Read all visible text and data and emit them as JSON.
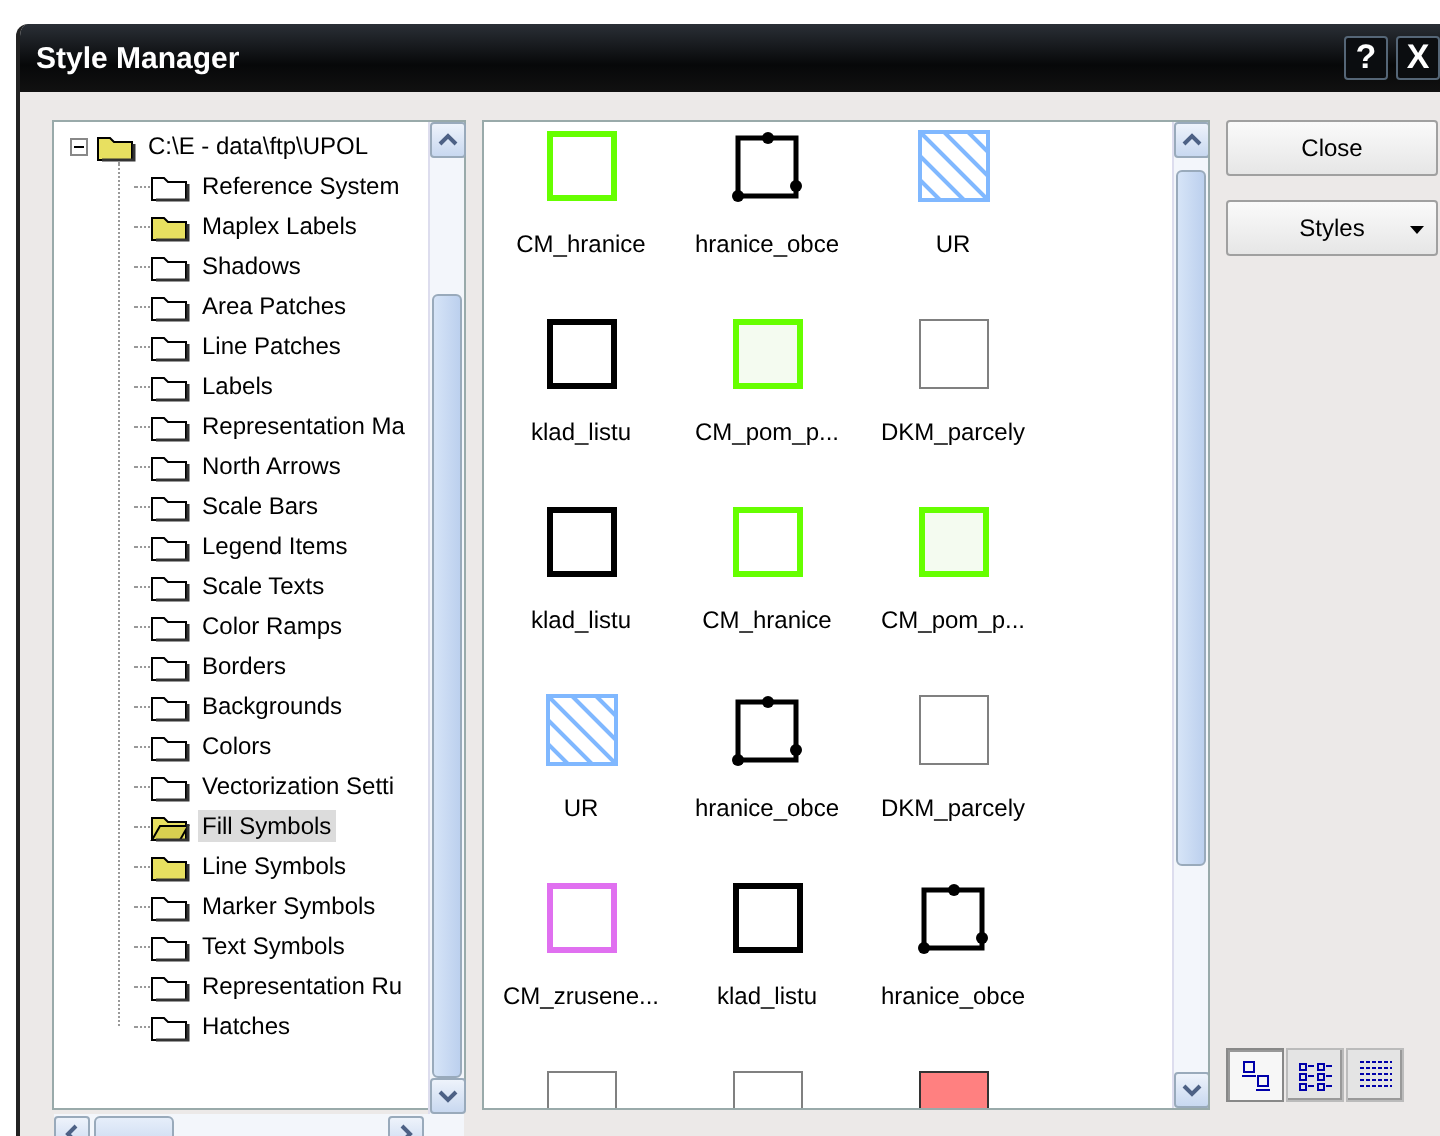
{
  "window": {
    "title": "Style Manager",
    "help": "?",
    "close": "X"
  },
  "tree": {
    "root": {
      "label": "C:\\E - data\\ftp\\UPOL",
      "expanded": true,
      "children": [
        {
          "label": "Reference System",
          "kind": "plain",
          "selected": false
        },
        {
          "label": "Maplex Labels",
          "kind": "yellow",
          "selected": false
        },
        {
          "label": "Shadows",
          "kind": "plain",
          "selected": false
        },
        {
          "label": "Area Patches",
          "kind": "plain",
          "selected": false
        },
        {
          "label": "Line Patches",
          "kind": "plain",
          "selected": false
        },
        {
          "label": "Labels",
          "kind": "plain",
          "selected": false
        },
        {
          "label": "Representation Ma",
          "kind": "plain",
          "selected": false
        },
        {
          "label": "North Arrows",
          "kind": "plain",
          "selected": false
        },
        {
          "label": "Scale Bars",
          "kind": "plain",
          "selected": false
        },
        {
          "label": "Legend Items",
          "kind": "plain",
          "selected": false
        },
        {
          "label": "Scale Texts",
          "kind": "plain",
          "selected": false
        },
        {
          "label": "Color Ramps",
          "kind": "plain",
          "selected": false
        },
        {
          "label": "Borders",
          "kind": "plain",
          "selected": false
        },
        {
          "label": "Backgrounds",
          "kind": "plain",
          "selected": false
        },
        {
          "label": "Colors",
          "kind": "plain",
          "selected": false
        },
        {
          "label": "Vectorization Setti",
          "kind": "plain",
          "selected": false
        },
        {
          "label": "Fill Symbols",
          "kind": "open",
          "selected": true
        },
        {
          "label": "Line Symbols",
          "kind": "yellow",
          "selected": false
        },
        {
          "label": "Marker Symbols",
          "kind": "plain",
          "selected": false
        },
        {
          "label": "Text Symbols",
          "kind": "plain",
          "selected": false
        },
        {
          "label": "Representation Ru",
          "kind": "plain",
          "selected": false
        },
        {
          "label": "Hatches",
          "kind": "plain",
          "selected": false
        }
      ]
    }
  },
  "symbols": [
    {
      "label": "CM_hranice",
      "kind": "outline",
      "color": "#66ff00"
    },
    {
      "label": "hranice_obce",
      "kind": "boundary",
      "color": "#000000"
    },
    {
      "label": "UR",
      "kind": "hatch",
      "color": "#80b8ff"
    },
    {
      "label": "klad_listu",
      "kind": "outline",
      "color": "#000000"
    },
    {
      "label": "CM_pom_p...",
      "kind": "tinted",
      "color": "#66ff00"
    },
    {
      "label": "DKM_parcely",
      "kind": "thin",
      "color": "#808080"
    },
    {
      "label": "klad_listu",
      "kind": "outline",
      "color": "#000000"
    },
    {
      "label": "CM_hranice",
      "kind": "outline",
      "color": "#66ff00"
    },
    {
      "label": "CM_pom_p...",
      "kind": "tinted",
      "color": "#66ff00"
    },
    {
      "label": "UR",
      "kind": "hatch",
      "color": "#80b8ff"
    },
    {
      "label": "hranice_obce",
      "kind": "boundary",
      "color": "#000000"
    },
    {
      "label": "DKM_parcely",
      "kind": "thin",
      "color": "#808080"
    },
    {
      "label": "CM_zrusene...",
      "kind": "outline",
      "color": "#e070f0"
    },
    {
      "label": "klad_listu",
      "kind": "outline",
      "color": "#000000"
    },
    {
      "label": "hranice_obce",
      "kind": "boundary",
      "color": "#000000"
    },
    {
      "kind": "thin",
      "color": "#808080"
    },
    {
      "kind": "thin",
      "color": "#808080"
    },
    {
      "kind": "solid",
      "color": "#ff8080"
    }
  ],
  "buttons": [
    {
      "label": "Close",
      "kind": "plain"
    },
    {
      "label": "Styles",
      "kind": "menu"
    }
  ],
  "view_buttons": [
    {
      "kind": "icons",
      "selected": true
    },
    {
      "kind": "list",
      "selected": false
    },
    {
      "kind": "details",
      "selected": false
    }
  ]
}
